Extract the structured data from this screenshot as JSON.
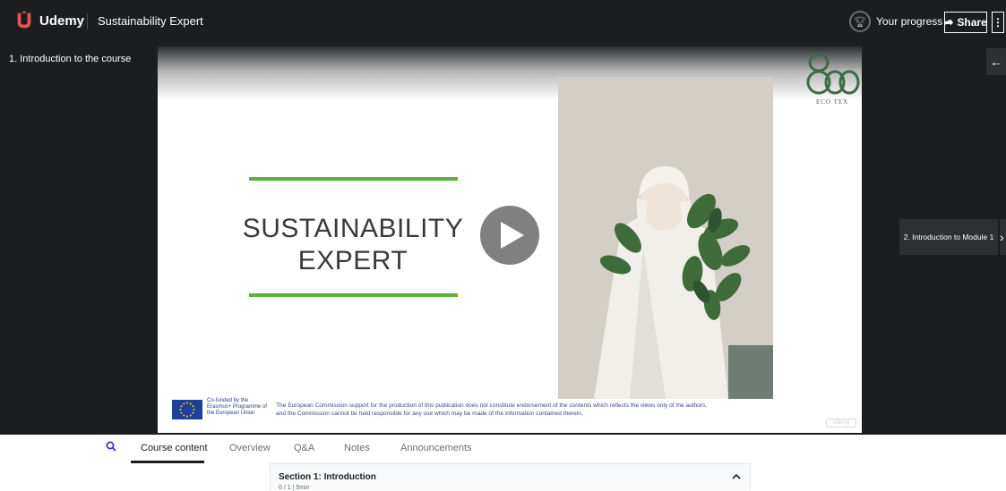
{
  "topbar": {
    "logo_text": "Udemy",
    "course_title": "Sustainability Expert",
    "progress_label": "Your progress",
    "share_label": "Share",
    "more_label": "⋮"
  },
  "player": {
    "current_lecture": "1. Introduction to the course",
    "next_lecture": "2. Introduction to Module 1",
    "back_icon": "←",
    "next_icon": "›"
  },
  "slide": {
    "title_line1": "SUSTAINABILITY",
    "title_line2": "EXPERT",
    "brand_sub": "ECO TEX",
    "eu_text": "Co-funded by the Erasmus+ Programme of the European Union",
    "disclaimer_line1": "The European Commission support for the production of this publication does not constitute endorsement of the contents which reflects the views only of the authors,",
    "disclaimer_line2": "and the Commission cannot be held responsible for any use which may be made of the information contained therein.",
    "watermark": "Udemy",
    "accent_color": "#5bb33a"
  },
  "tabs": {
    "items": [
      "Course content",
      "Overview",
      "Q&A",
      "Notes",
      "Announcements"
    ],
    "active": "Course content"
  },
  "section": {
    "title": "Section 1: Introduction",
    "meta": "0 / 1 | 5min"
  },
  "colors": {
    "brand": "#a435f0",
    "topbar_bg": "#1c1d1f"
  }
}
